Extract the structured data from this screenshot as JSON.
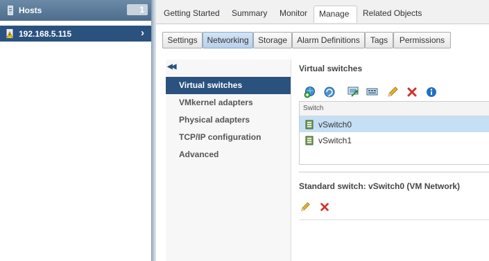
{
  "navigator": {
    "title": "Hosts",
    "count": "1",
    "selected_host": "192.168.5.115"
  },
  "top_tabs": [
    "Getting Started",
    "Summary",
    "Monitor",
    "Manage",
    "Related Objects"
  ],
  "active_top_tab": "Manage",
  "sub_tabs": [
    "Settings",
    "Networking",
    "Storage",
    "Alarm Definitions",
    "Tags",
    "Permissions"
  ],
  "active_sub_tab": "Networking",
  "menu": {
    "items": [
      "Virtual switches",
      "VMkernel adapters",
      "Physical adapters",
      "TCP/IP configuration",
      "Advanced"
    ],
    "active": "Virtual switches"
  },
  "virtual_switches": {
    "title": "Virtual switches",
    "toolbar_icons": [
      "add-networking-icon",
      "refresh-icon",
      "migrate-icon",
      "adapter-settings-icon",
      "edit-pencil-icon",
      "delete-icon",
      "info-icon"
    ],
    "column_header": "Switch",
    "rows": [
      {
        "name": "vSwitch0",
        "selected": true
      },
      {
        "name": "vSwitch1",
        "selected": false
      }
    ]
  },
  "standard_switch": {
    "title": "Standard switch: vSwitch0 (VM Network)",
    "toolbar_icons": [
      "edit-pencil-icon",
      "delete-icon"
    ]
  },
  "colors": {
    "selection_dark": "#2b527f",
    "row_selected": "#c5dff5",
    "delete_red": "#d0312d",
    "info_blue": "#1f6fc5"
  }
}
